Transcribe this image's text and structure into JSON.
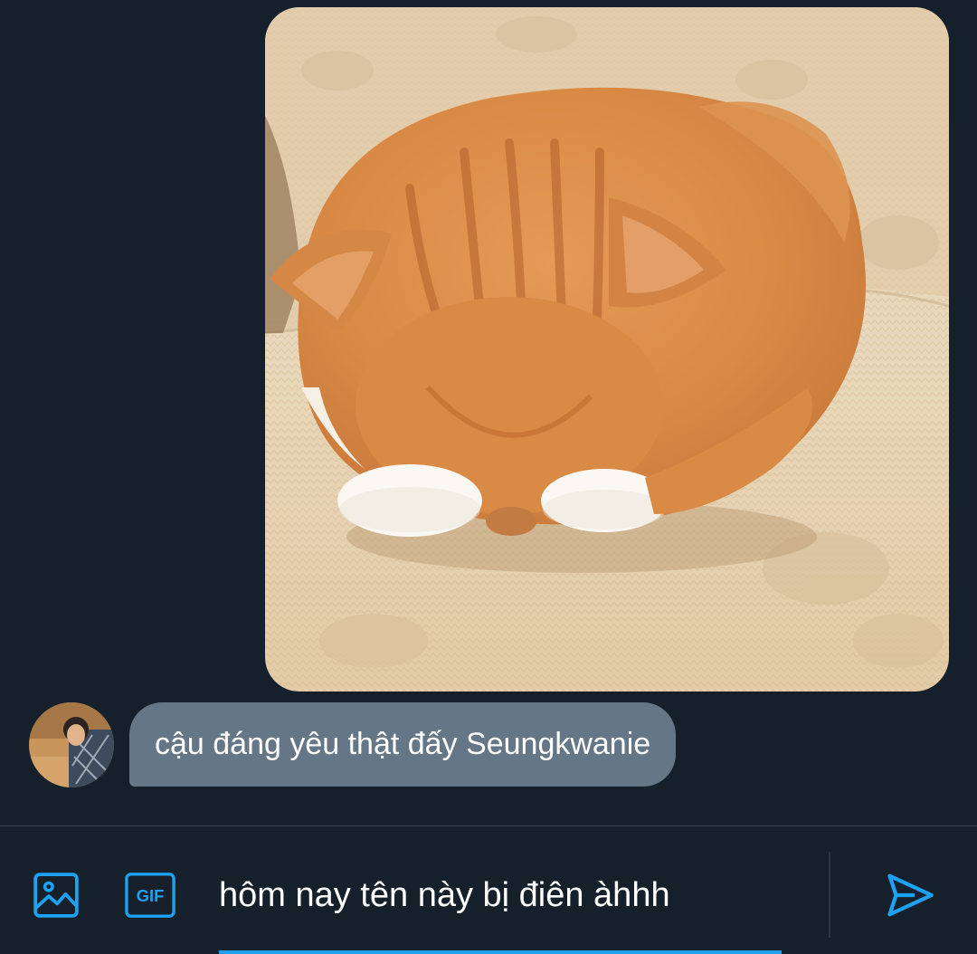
{
  "conversation": {
    "image_message": {
      "icon": "photo-attachment"
    },
    "received_message": {
      "text": "cậu đáng yêu thật đấy Seungkwanie"
    }
  },
  "composer": {
    "input_value": "hôm nay tên này bị điên àhhh",
    "media_icon": "image-icon",
    "gif_label": "GIF",
    "send_icon": "send-icon"
  },
  "colors": {
    "background": "#15202b",
    "bubble": "#657786",
    "accent": "#1da1f2",
    "divider": "#38444d"
  }
}
